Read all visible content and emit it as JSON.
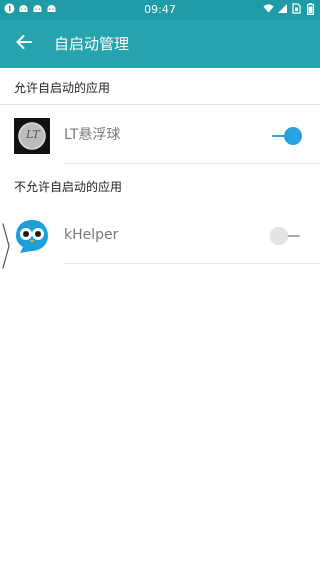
{
  "status_bar": {
    "time": "09:47",
    "left_icons": [
      "notification-icon",
      "android-icon",
      "android-icon",
      "android-icon"
    ],
    "right_icons": [
      "wifi-icon",
      "signal-icon",
      "sim-icon",
      "battery-icon"
    ]
  },
  "app_bar": {
    "title": "自启动管理",
    "back_icon": "arrow-left-icon",
    "background": "#27a3ae",
    "status_background": "#1e9ba6"
  },
  "sections": [
    {
      "header": "允许自启动的应用",
      "apps": [
        {
          "name": "LT悬浮球",
          "icon_text": "LT",
          "icon": "lt-float-ball-icon",
          "enabled": true
        }
      ]
    },
    {
      "header": "不允许自启动的应用",
      "apps": [
        {
          "name": "kHelper",
          "icon": "khelper-owl-icon",
          "enabled": false
        }
      ]
    }
  ],
  "colors": {
    "toggle_on": "#27a3e3",
    "toggle_off": "#e4e4e4",
    "label": "#7a7a7a"
  }
}
